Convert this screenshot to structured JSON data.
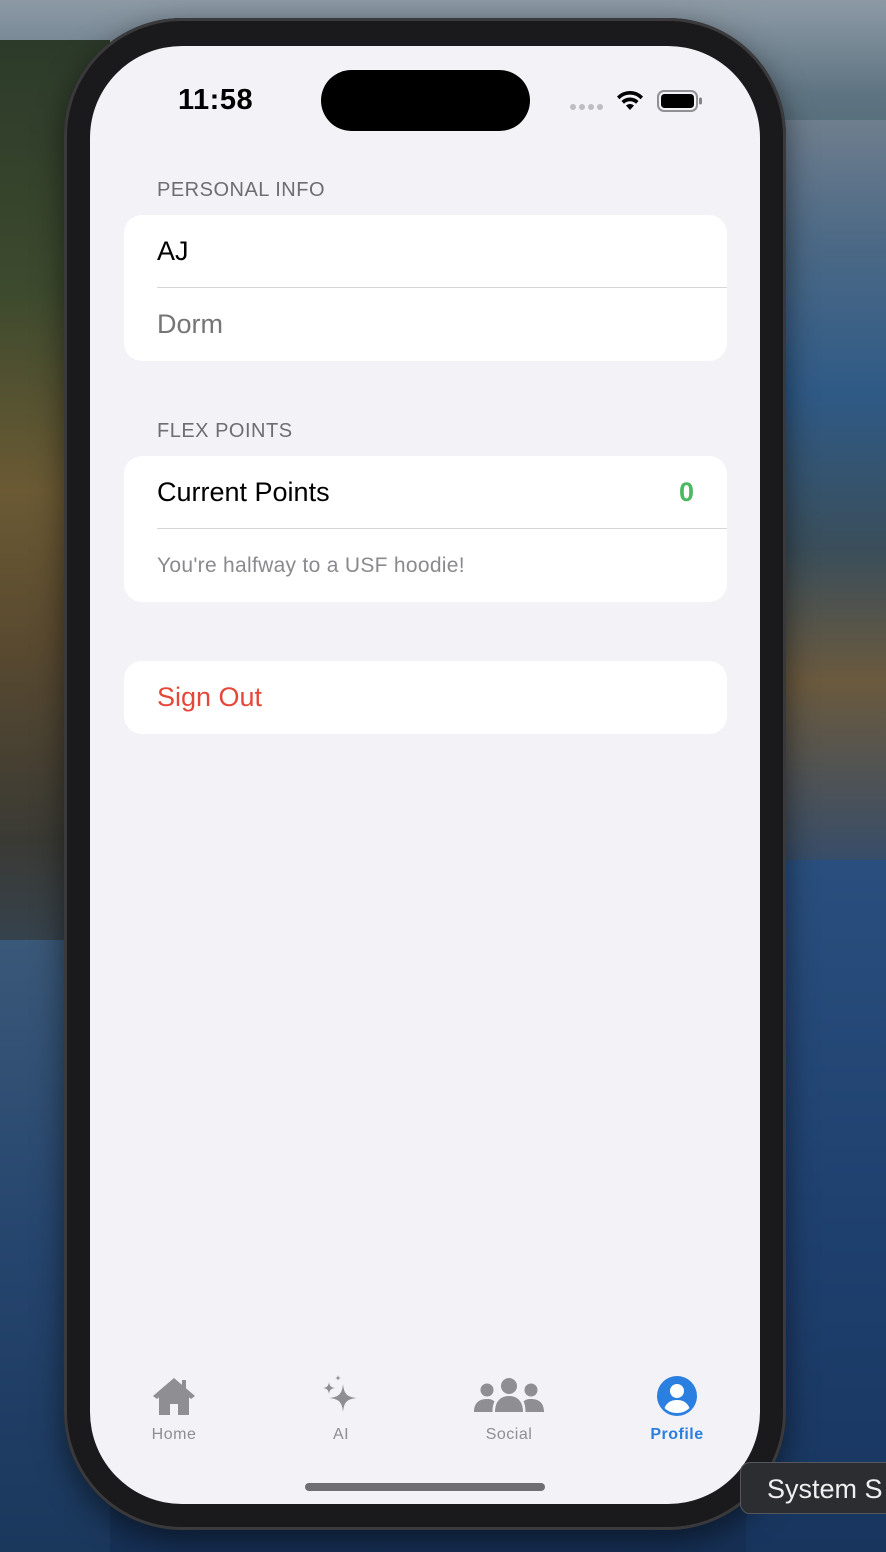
{
  "status_bar": {
    "time": "11:58"
  },
  "personal_info": {
    "header": "PERSONAL INFO",
    "name": "AJ",
    "dorm_placeholder": "Dorm"
  },
  "flex_points": {
    "header": "FLEX POINTS",
    "current_label": "Current Points",
    "current_value": "0",
    "note": "You're halfway to a USF hoodie!"
  },
  "actions": {
    "sign_out": "Sign Out"
  },
  "tabbar": {
    "items": [
      {
        "label": "Home",
        "icon": "house-icon"
      },
      {
        "label": "AI",
        "icon": "sparkles-icon"
      },
      {
        "label": "Social",
        "icon": "people-icon"
      },
      {
        "label": "Profile",
        "icon": "person-circle-icon"
      }
    ],
    "active": "Profile"
  },
  "desktop_tooltip": {
    "text": "System S"
  },
  "colors": {
    "accent": "#2b7fe0",
    "points_value": "#4cb861",
    "destructive": "#e5483b",
    "background": "#f2f2f7"
  }
}
